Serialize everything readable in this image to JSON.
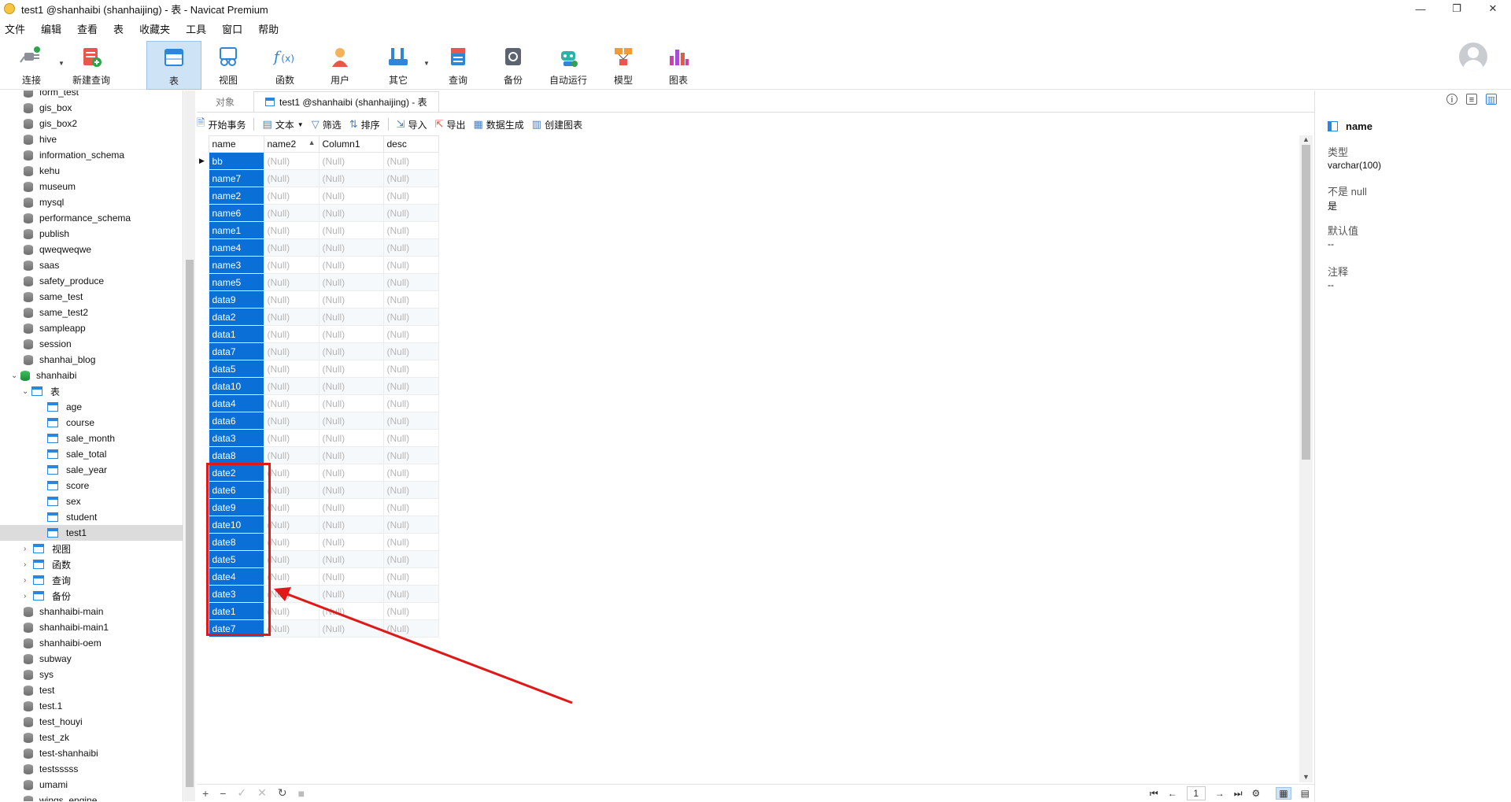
{
  "window": {
    "title": "test1 @shanhaibi (shanhaijing) - 表 - Navicat Premium",
    "minimize": "—",
    "restore": "❐",
    "close": "✕"
  },
  "menu": [
    "文件",
    "编辑",
    "查看",
    "表",
    "收藏夹",
    "工具",
    "窗口",
    "帮助"
  ],
  "toolbar": {
    "connect": "连接",
    "new_query": "新建查询",
    "table": "表",
    "view": "视图",
    "function": "函数",
    "user": "用户",
    "other": "其它",
    "query": "查询",
    "backup": "备份",
    "autorun": "自动运行",
    "model": "模型",
    "chart": "图表"
  },
  "sidebar": {
    "databases_top": [
      "form_test",
      "gis_box",
      "gis_box2",
      "hive",
      "information_schema",
      "kehu",
      "museum",
      "mysql",
      "performance_schema",
      "publish",
      "qweqweqwe",
      "saas",
      "safety_produce",
      "same_test",
      "same_test2",
      "sampleapp",
      "session",
      "shanhai_blog"
    ],
    "open_db": "shanhaibi",
    "tables_folder": "表",
    "tables": [
      "age",
      "course",
      "sale_month",
      "sale_total",
      "sale_year",
      "score",
      "sex",
      "student",
      "test1"
    ],
    "views_folder": "视图",
    "functions_folder": "函数",
    "queries_folder": "查询",
    "backups_folder": "备份",
    "databases_bottom": [
      "shanhaibi-main",
      "shanhaibi-main1",
      "shanhaibi-oem",
      "subway",
      "sys",
      "test",
      "test.1",
      "test_houyi",
      "test_zk",
      "test-shanhaibi",
      "testsssss",
      "umami",
      "wings_engine"
    ]
  },
  "tabs": {
    "objects": "对象",
    "active": "test1 @shanhaibi (shanhaijing) - 表"
  },
  "subtoolbar": {
    "begin_tx": "开始事务",
    "text": "文本",
    "filter": "筛选",
    "sort": "排序",
    "import": "导入",
    "export": "导出",
    "datagen": "数据生成",
    "create_chart": "创建图表"
  },
  "grid": {
    "columns": [
      "name",
      "name2",
      "Column1",
      "desc"
    ],
    "null_text": "(Null)",
    "rows": [
      "bb",
      "name7",
      "name2",
      "name6",
      "name1",
      "name4",
      "name3",
      "name5",
      "data9",
      "data2",
      "data1",
      "data7",
      "data5",
      "data10",
      "data4",
      "data6",
      "data3",
      "data8",
      "date2",
      "date6",
      "date9",
      "date10",
      "date8",
      "date5",
      "date4",
      "date3",
      "date1",
      "date7"
    ]
  },
  "pager": {
    "page": "1"
  },
  "field_panel": {
    "field_name": "name",
    "type_label": "类型",
    "type_value": "varchar(100)",
    "notnull_label": "不是 null",
    "notnull_value": "是",
    "default_label": "默认值",
    "default_value": "--",
    "comment_label": "注释",
    "comment_value": "--"
  },
  "colors": {
    "selection": "#0a6fd6",
    "highlight_box": "#e01818",
    "arrow": "#e01818"
  }
}
